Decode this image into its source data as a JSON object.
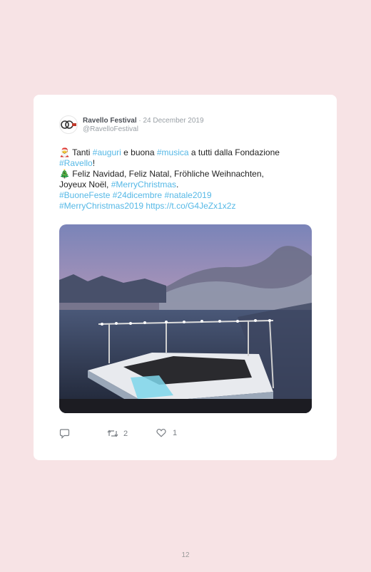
{
  "tweet": {
    "author_name": "Ravello Festival",
    "separator": "·",
    "date": "24 December 2019",
    "handle": "@RavelloFestival",
    "avatar_logo_text": "RCF",
    "line1": {
      "emoji": "🎅",
      "t1": "Tanti ",
      "tag1": "#auguri",
      "t2": " e buona ",
      "tag2": "#musica",
      "t3": " a tutti dalla Fondazione"
    },
    "line2": {
      "tag": "#Ravello",
      "t": "!"
    },
    "line3": {
      "emoji": "🎄",
      "t": "Feliz Navidad, Feliz Natal, Fröhliche Weihnachten,"
    },
    "line4": {
      "t": "Joyeux Noël, ",
      "tag": "#MerryChristmas",
      "t2": "."
    },
    "line5": {
      "tag1": "#BuoneFeste",
      "tag2": "#24dicembre",
      "tag3": "#natale2019"
    },
    "line6": {
      "tag": "#MerryChristmas2019",
      "url": "https://t.co/G4JeZx1x2z"
    },
    "actions": {
      "reply_icon": "reply-icon",
      "retweet_icon": "retweet-icon",
      "retweet_count": "2",
      "like_icon": "heart-icon",
      "like_count": "1"
    }
  },
  "page_number": "12",
  "colors": {
    "background": "#f7e3e5",
    "card": "#ffffff",
    "link": "#55b8e6"
  }
}
